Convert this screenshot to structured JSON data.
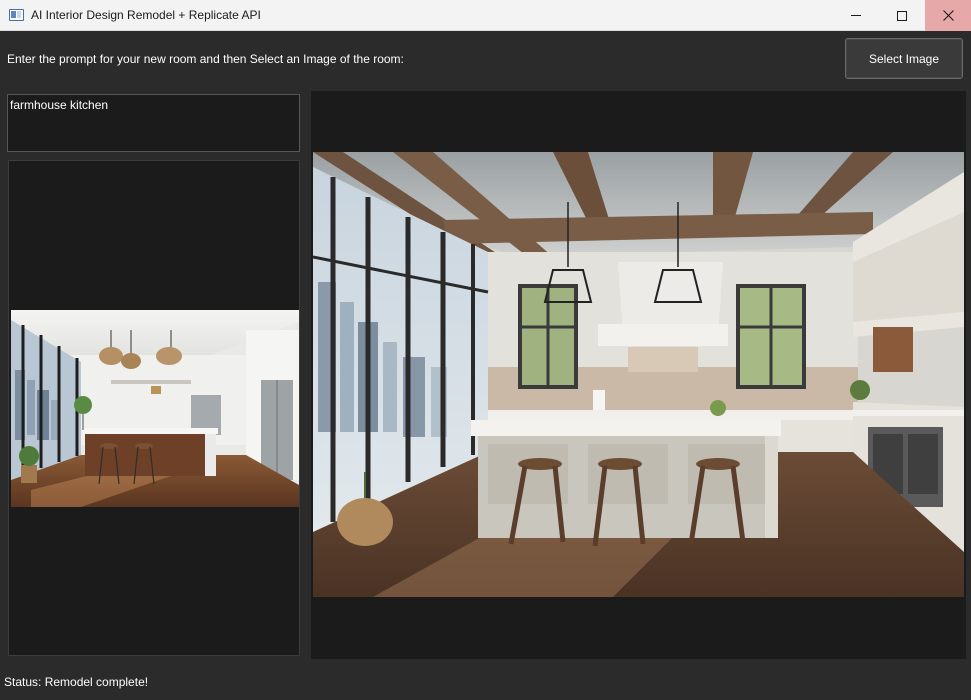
{
  "window": {
    "title": "AI Interior Design Remodel + Replicate API",
    "icon": "app-window-icon",
    "controls": [
      "minimize-icon",
      "maximize-icon",
      "close-icon"
    ],
    "close_hover_color": "#e6a8a8"
  },
  "header": {
    "instruction": "Enter the prompt for your new room and then Select an Image of the room:",
    "select_button_label": "Select Image"
  },
  "prompt": {
    "value": "farmhouse kitchen"
  },
  "images": {
    "original": "modern-kitchen-photo",
    "result": "farmhouse-kitchen-render"
  },
  "status": {
    "text": "Status: Remodel complete!"
  },
  "colors": {
    "background": "#2b2b2b",
    "panel": "#1b1b1b",
    "titlebar": "#f3f3f3",
    "text": "#ffffff"
  }
}
